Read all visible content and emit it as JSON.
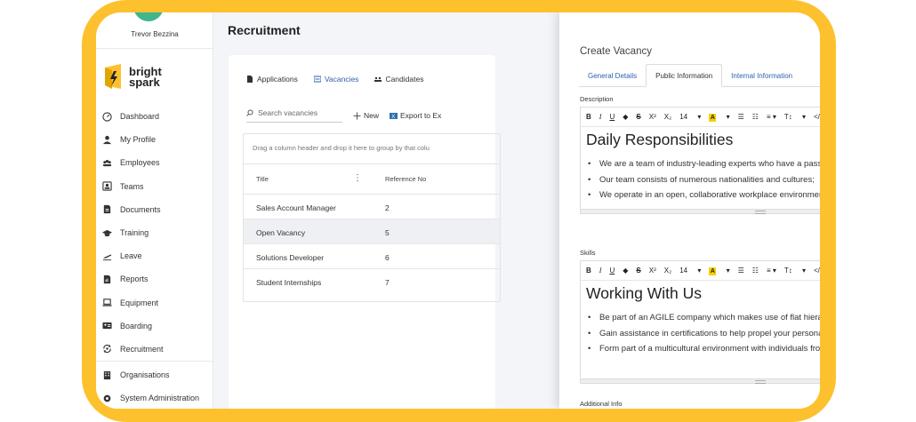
{
  "user": {
    "name": "Trevor Bezzina"
  },
  "brand": {
    "line1": "bright",
    "line2": "spark",
    "accent": "#fdc12d"
  },
  "sidebar": {
    "items": [
      {
        "label": "Dashboard",
        "icon": "dashboard-icon"
      },
      {
        "label": "My Profile",
        "icon": "user-icon"
      },
      {
        "label": "Employees",
        "icon": "users-icon"
      },
      {
        "label": "Teams",
        "icon": "teams-icon"
      },
      {
        "label": "Documents",
        "icon": "document-icon"
      },
      {
        "label": "Training",
        "icon": "graduation-cap-icon"
      },
      {
        "label": "Leave",
        "icon": "plane-icon"
      },
      {
        "label": "Reports",
        "icon": "report-icon"
      },
      {
        "label": "Equipment",
        "icon": "laptop-icon"
      },
      {
        "label": "Boarding",
        "icon": "id-card-icon"
      },
      {
        "label": "Recruitment",
        "icon": "recruitment-icon"
      }
    ],
    "items2": [
      {
        "label": "Organisations",
        "icon": "building-icon"
      },
      {
        "label": "System Administration",
        "icon": "gear-icon"
      }
    ]
  },
  "page": {
    "title": "Recruitment"
  },
  "recruit_tabs": [
    "Applications",
    "Vacancies",
    "Candidates"
  ],
  "toolbar": {
    "search_placeholder": "Search vacancies",
    "new_label": "New",
    "export_label": "Export to Ex"
  },
  "grid": {
    "group_hint": "Drag a column header and drop it here to group by that colu",
    "headers": [
      "Title",
      "Reference No"
    ],
    "rows": [
      {
        "title": "Sales Account Manager",
        "ref": "2"
      },
      {
        "title": "Open Vacancy",
        "ref": "5"
      },
      {
        "title": "Solutions Developer",
        "ref": "6"
      },
      {
        "title": "Student Internships",
        "ref": "7"
      }
    ]
  },
  "panel": {
    "title": "Create Vacancy",
    "tabs": [
      "General Details",
      "Public Information",
      "Internal Information"
    ],
    "description_label": "Description",
    "skills_label": "Skills",
    "additional_label": "Additional Info",
    "editor_toolbar": {
      "font_size": "14",
      "text_type": "T↕"
    },
    "description": {
      "heading": "Daily Responsibilities",
      "items": [
        "We are a team of industry-leading experts who have a passion for technology;",
        "Our team consists of numerous nationalities and cultures;",
        "We operate in an open, collaborative workplace environment that rewards"
      ]
    },
    "skills": {
      "heading": "Working With Us",
      "items": [
        "Be part of an AGILE company which makes use of flat hierarchies;",
        "Gain assistance in certifications to help propel your personal skillset;",
        "Form part of a multicultural environment with individuals from all walks of life;"
      ]
    }
  }
}
